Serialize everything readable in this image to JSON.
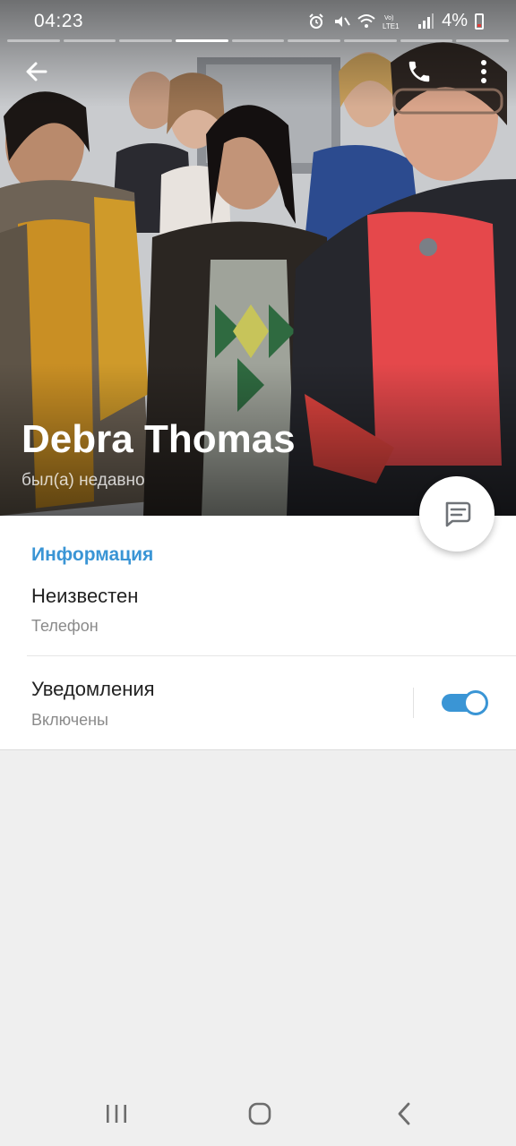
{
  "status_bar": {
    "time": "04:23",
    "battery": "4%",
    "network_label": "Vo) LTE1",
    "icons": [
      "alarm-icon",
      "mute-icon",
      "wifi-icon",
      "volte-icon",
      "signal-icon",
      "battery-icon"
    ]
  },
  "stories": {
    "segments": 9,
    "active_index": 3
  },
  "profile": {
    "name": "Debra Thomas",
    "status": "был(а) недавно"
  },
  "actions": {
    "back_icon": "arrow-left-icon",
    "call_icon": "phone-icon",
    "more_icon": "more-vertical-icon",
    "message_icon": "chat-bubble-icon"
  },
  "info": {
    "section_title": "Информация",
    "phone_value": "Неизвестен",
    "phone_label": "Телефон",
    "notifications_title": "Уведомления",
    "notifications_state": "Включены",
    "notifications_enabled": true
  },
  "colors": {
    "accent": "#3a95d5",
    "background": "#efefef"
  },
  "nav": {
    "icons": [
      "recent-apps-icon",
      "home-icon",
      "back-icon"
    ]
  }
}
